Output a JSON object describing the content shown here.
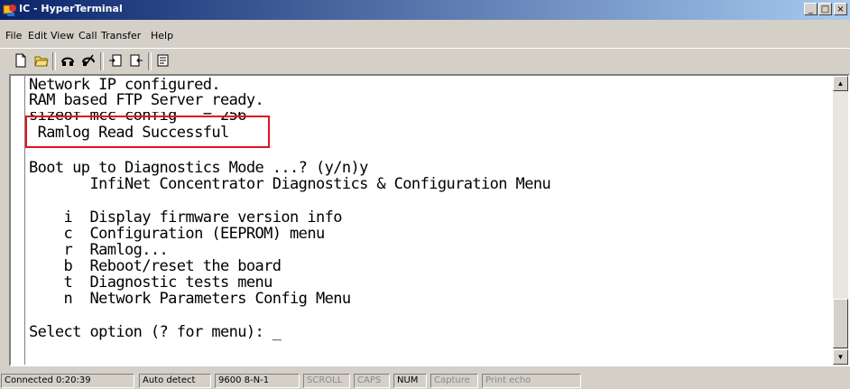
{
  "window": {
    "title": "IC - HyperTerminal",
    "minimize": "_",
    "maximize": "□",
    "close": "×"
  },
  "menu": [
    "File",
    "Edit",
    "View",
    "Call",
    "Transfer",
    "Help"
  ],
  "toolbar": {
    "icons": [
      "new-connection-icon",
      "open-icon",
      "connect-icon",
      "disconnect-icon",
      "send-icon",
      "receive-icon",
      "properties-icon"
    ]
  },
  "terminal": {
    "lines": [
      "Network IP configured.",
      "RAM based FTP Server ready.",
      "sizeof mcc config   = 256",
      " Ramlog Read Successful",
      "",
      "Boot up to Diagnostics Mode ...? (y/n)y",
      "       InfiNet Concentrator Diagnostics & Configuration Menu",
      "",
      "    i  Display firmware version info",
      "    c  Configuration (EEPROM) menu",
      "    r  Ramlog...",
      "    b  Reboot/reset the board",
      "    t  Diagnostic tests menu",
      "    n  Network Parameters Config Menu",
      "",
      "Select option (? for menu): _"
    ],
    "highlight_color": "#e0141e"
  },
  "status": {
    "connected": "Connected 0:20:39",
    "detect": "Auto detect",
    "settings": "9600 8-N-1",
    "scroll": "SCROLL",
    "caps": "CAPS",
    "num": "NUM",
    "capture": "Capture",
    "print_echo": "Print echo"
  }
}
